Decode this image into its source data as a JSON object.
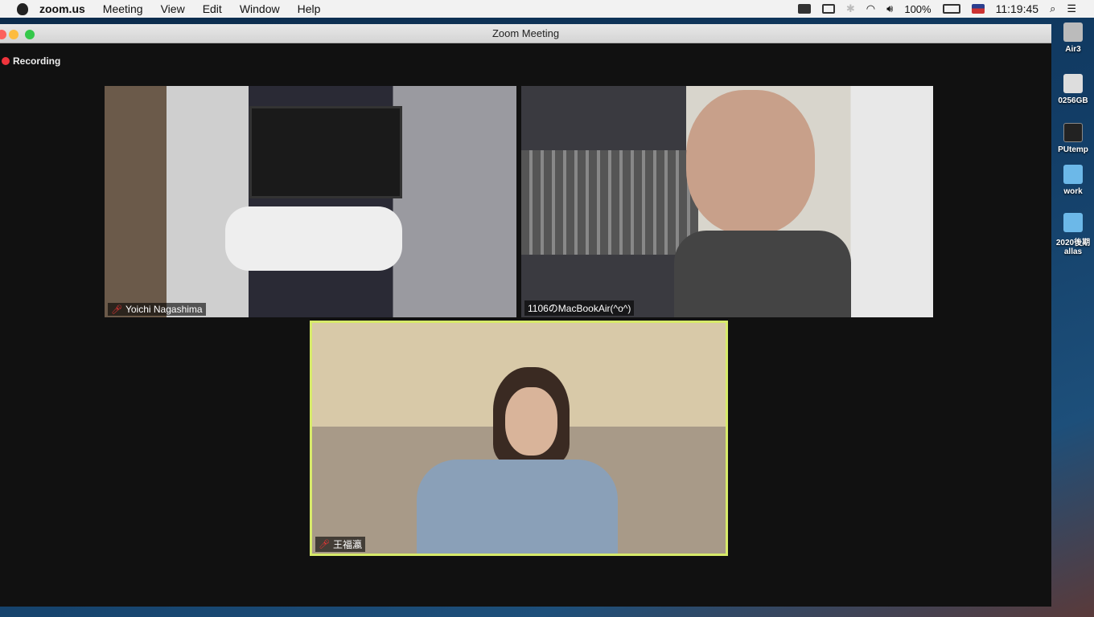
{
  "menubar": {
    "app": "zoom.us",
    "items": [
      "Meeting",
      "View",
      "Edit",
      "Window",
      "Help"
    ],
    "battery": "100%",
    "time": "11:19:45"
  },
  "window": {
    "title": "Zoom Meeting",
    "recording": "Recording"
  },
  "participants": [
    {
      "name": "Yoichi Nagashima",
      "muted": true
    },
    {
      "name": "1106のMacBookAir(^o^)",
      "muted": false
    },
    {
      "name": "王福瀛",
      "muted": true,
      "active_speaker": true
    }
  ],
  "desktop": [
    "Air3",
    "0256GB",
    "PUtemp",
    "work",
    "2020後期 allas"
  ],
  "colors": {
    "active": "#d7ea6a",
    "record": "#f0343c"
  }
}
